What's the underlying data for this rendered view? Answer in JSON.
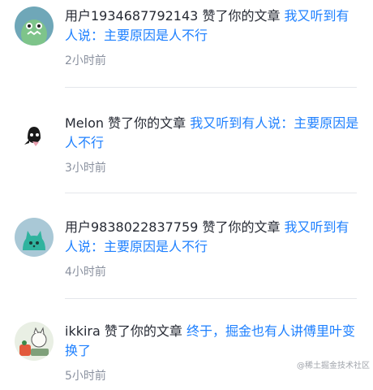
{
  "notifications": [
    {
      "user": "用户1934687792143",
      "action": "赞了你的文章",
      "article": "我又听到有人说：主要原因是人不行",
      "time": "2小时前",
      "avatar_icon": "green-monster-avatar"
    },
    {
      "user": "Melon",
      "action": "赞了你的文章",
      "article": "我又听到有人说：主要原因是人不行",
      "time": "3小时前",
      "avatar_icon": "cartoon-character-avatar"
    },
    {
      "user": "用户9838022837759",
      "action": "赞了你的文章",
      "article": "我又听到有人说：主要原因是人不行",
      "time": "4小时前",
      "avatar_icon": "teal-cat-avatar"
    },
    {
      "user": "ikkira",
      "action": "赞了你的文章",
      "article": "终于，掘金也有人讲傅里叶变换了",
      "time": "5小时前",
      "avatar_icon": "illustration-avatar"
    }
  ],
  "watermark": "@稀土掘金技术社区",
  "colors": {
    "link": "#1e80ff",
    "text": "#252933",
    "muted": "#8a919f",
    "divider": "#e4e6eb"
  }
}
